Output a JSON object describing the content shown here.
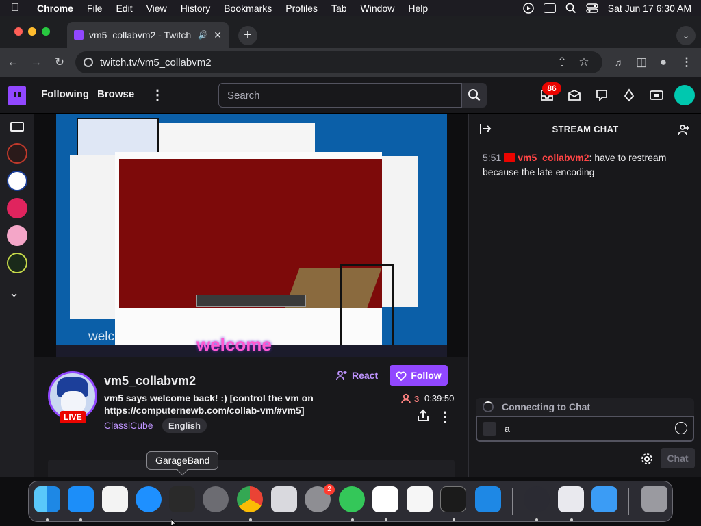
{
  "menubar": {
    "app_name": "Chrome",
    "items": [
      "File",
      "Edit",
      "View",
      "History",
      "Bookmarks",
      "Profiles",
      "Tab",
      "Window",
      "Help"
    ],
    "clock": "Sat Jun 17  6:30 AM"
  },
  "browser": {
    "tab_title": "vm5_collabvm2 - Twitch",
    "url": "twitch.tv/vm5_collabvm2"
  },
  "twitch_nav": {
    "following": "Following",
    "browse": "Browse",
    "search_placeholder": "Search",
    "notifications_count": "86"
  },
  "player": {
    "overlay_text": "welcome",
    "watermark_text": "welc"
  },
  "channel": {
    "name": "vm5_collabvm2",
    "live_label": "LIVE",
    "title": "vm5 says welcome back! :) [control the vm on https://computernewb.com/collab-vm/#vm5]",
    "category": "ClassiCube",
    "tag": "English",
    "react_label": "React",
    "follow_label": "Follow",
    "viewer_count": "3",
    "uptime": "0:39:50"
  },
  "chat": {
    "header": "STREAM CHAT",
    "messages": [
      {
        "time": "5:51",
        "user": "vm5_collabvm2",
        "text": ": have to restream because the late encoding"
      }
    ],
    "status": "Connecting to Chat",
    "input_value": "a",
    "send_label": "Chat"
  },
  "dock": {
    "tooltip": "GarageBand",
    "icons": [
      "finder-icon",
      "app-store-icon",
      "textedit-icon",
      "safari-icon",
      "garageband-icon",
      "settings-gear-icon",
      "chrome-icon",
      "launchpad-icon",
      "system-settings-icon",
      "find-my-icon",
      "vscode-icon",
      "freeform-icon",
      "terminal-icon",
      "screen-sharing-icon",
      "obs-icon",
      "installer-icon",
      "mail-icon",
      "trash-icon"
    ],
    "system_settings_badge": "2"
  },
  "colors": {
    "twitch_purple": "#9147ff",
    "live_red": "#eb0400",
    "chat_username": "#ff4545"
  }
}
